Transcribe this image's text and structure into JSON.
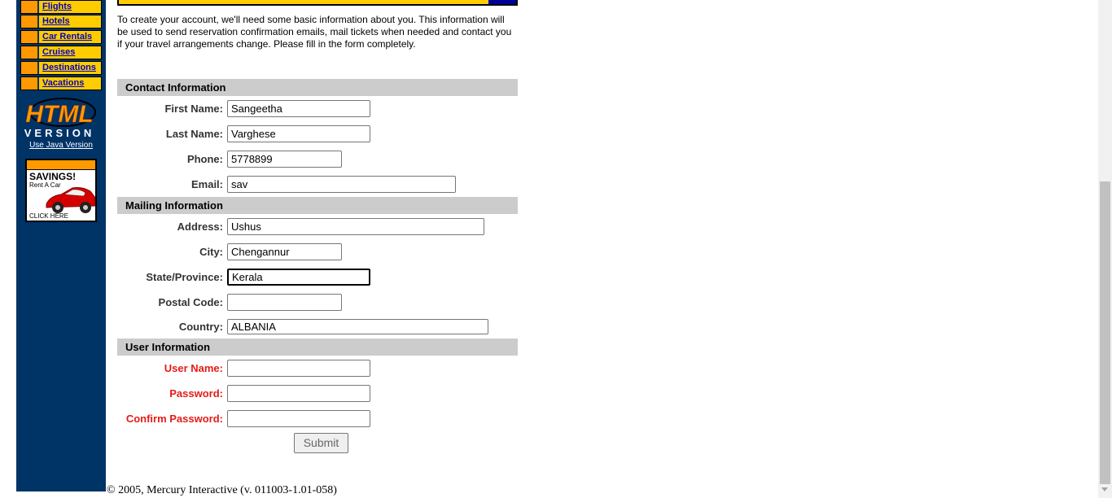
{
  "sidebar": {
    "items": [
      {
        "label": "Flights"
      },
      {
        "label": "Hotels"
      },
      {
        "label": "Car Rentals"
      },
      {
        "label": "Cruises"
      },
      {
        "label": "Destinations"
      },
      {
        "label": "Vacations"
      }
    ],
    "logo_line1": "HTML",
    "logo_line2": "VERSION",
    "java_link": "Use Java Version",
    "ad": {
      "title": "SAVINGS!",
      "subtitle": "Rent A Car",
      "cta": "CLICK HERE"
    }
  },
  "intro": "To create your account, we'll need some basic information about you. This information will be used to send reservation confirmation emails, mail tickets when needed and contact you if your travel arrangements change. Please fill in the form completely.",
  "contact": {
    "heading": "Contact Information",
    "first_name_label": "First Name:",
    "first_name_value": "Sangeetha",
    "last_name_label": "Last Name:",
    "last_name_value": "Varghese",
    "phone_label": "Phone:",
    "phone_value": "5778899",
    "email_label": "Email:",
    "email_value": "sav"
  },
  "mailing": {
    "heading": "Mailing Information",
    "address_label": "Address:",
    "address_value": "Ushus",
    "city_label": "City:",
    "city_value": "Chengannur",
    "state_label": "State/Province:",
    "state_value": "Kerala",
    "postal_label": "Postal Code:",
    "postal_value": "",
    "country_label": "Country:",
    "country_value": "ALBANIA"
  },
  "user": {
    "heading": "User Information",
    "username_label": "User Name:",
    "username_value": "",
    "password_label": "Password:",
    "password_value": "",
    "confirm_label": "Confirm Password:",
    "confirm_value": ""
  },
  "submit_label": "Submit",
  "footer": "© 2005, Mercury Interactive (v. 011003-1.01-058)",
  "colors": {
    "sidebar_bg": "#003366",
    "nav_bg": "#FFCC00",
    "nav_square": "#FF9900",
    "section_bg": "#CCCCCC",
    "required_label": "#E41B17"
  }
}
